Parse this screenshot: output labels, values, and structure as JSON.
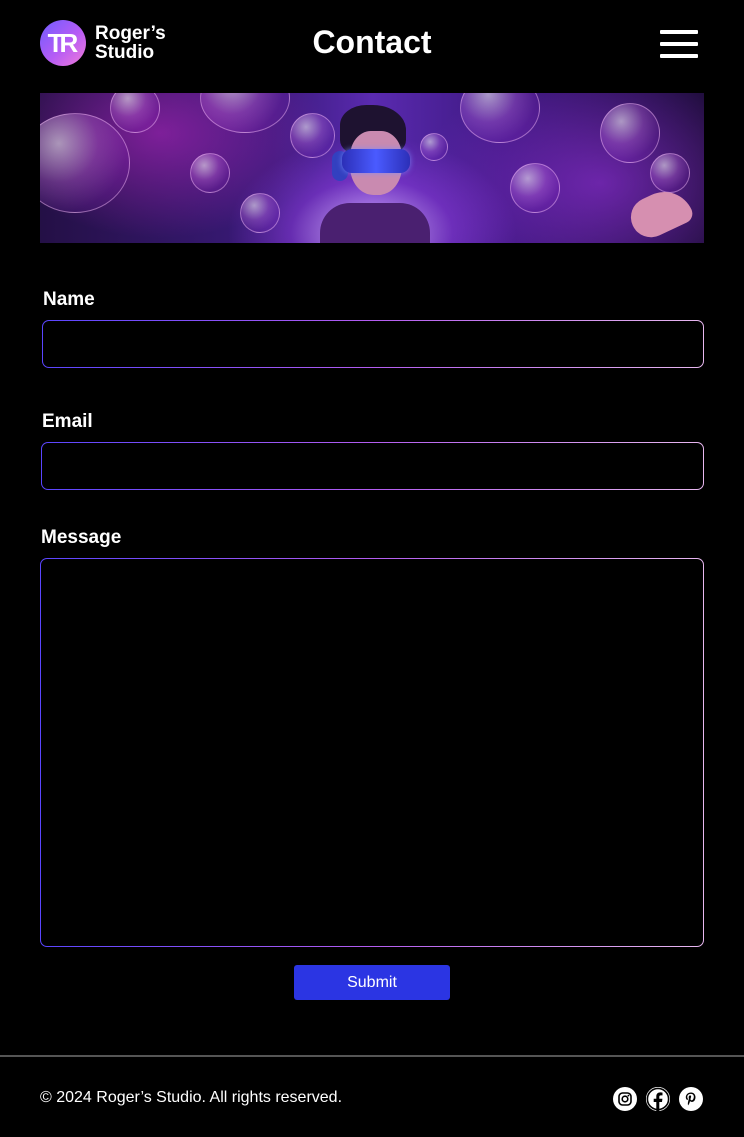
{
  "header": {
    "logo_monogram": "TR",
    "logo_line1": "Roger’s",
    "logo_line2": "Studio",
    "title": "Contact",
    "menu_icon": "hamburger-menu-icon"
  },
  "hero": {
    "image_description_icon": "vr-headset-banner"
  },
  "form": {
    "name_label": "Name",
    "name_value": "",
    "email_label": "Email",
    "email_value": "",
    "message_label": "Message",
    "message_value": "",
    "submit_label": "Submit",
    "accent": "#2b35e3",
    "border_gradient": [
      "#5a45ff",
      "#b35cf0",
      "#e8b8f0"
    ]
  },
  "footer": {
    "copyright": "© 2024 Roger’s Studio. All rights reserved.",
    "social_icons": [
      "instagram-icon",
      "facebook-icon",
      "pinterest-icon"
    ]
  }
}
